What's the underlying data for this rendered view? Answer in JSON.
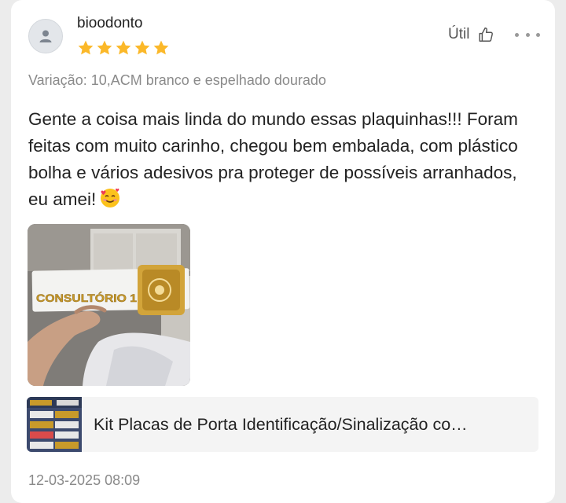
{
  "review": {
    "username": "bioodonto",
    "rating": 5,
    "rating_max": 5,
    "helpful_label": "Útil",
    "variation": "Variação: 10,ACM branco e espelhado dourado",
    "text": "Gente a coisa mais linda do mundo essas plaquinhas!!! Foram feitas com muito carinho, chegou bem embalada, com plástico bolha e vários adesivos pra proteger de possíveis arranhados, eu amei!",
    "emoji": "smiling-face-with-hearts",
    "photo_sign_text": "CONSULTÓRIO 1",
    "product_title": "Kit Placas de Porta Identificação/Sinalização co…",
    "timestamp": "12-03-2025 08:09"
  },
  "colors": {
    "star": "#fbb829",
    "muted_text": "#8a8a8a",
    "product_bg": "#f4f4f4",
    "gold": "#c89a2a"
  },
  "icons": [
    "user-avatar-icon",
    "star-icon",
    "thumbs-up-icon",
    "more-options-icon"
  ]
}
